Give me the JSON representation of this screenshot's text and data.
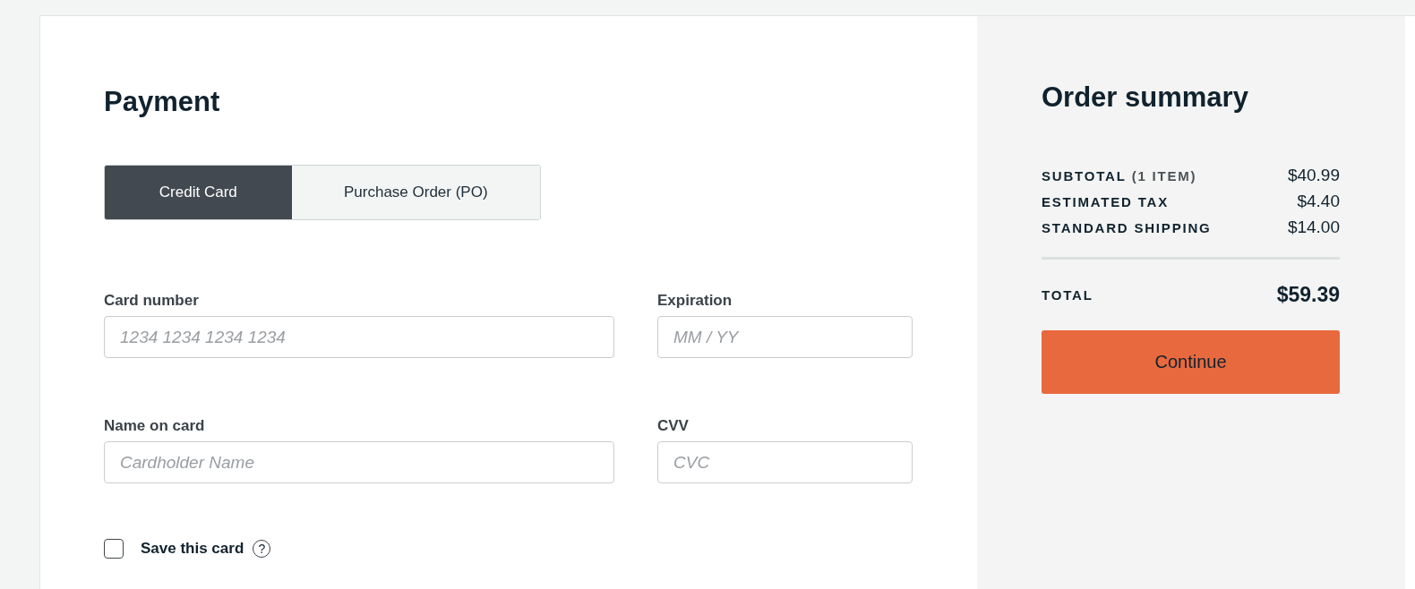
{
  "payment": {
    "title": "Payment",
    "tabs": [
      {
        "label": "Credit Card",
        "selected": true
      },
      {
        "label": "Purchase Order (PO)",
        "selected": false
      }
    ],
    "fields": [
      {
        "label": "Card number",
        "placeholder": "1234 1234 1234 1234"
      },
      {
        "label": "Expiration",
        "placeholder": "MM / YY"
      },
      {
        "label": "Name on card",
        "placeholder": "Cardholder Name"
      },
      {
        "label": "CVV",
        "placeholder": "CVC"
      }
    ],
    "save_card": {
      "label": "Save this card",
      "checked": false,
      "help_icon": "?"
    }
  },
  "order_summary": {
    "title": "Order summary",
    "lines": [
      {
        "label": "SUBTOTAL",
        "note": "(1 ITEM)",
        "amount": "$40.99"
      },
      {
        "label": "ESTIMATED TAX",
        "amount": "$4.40"
      },
      {
        "label": "STANDARD SHIPPING",
        "amount": "$14.00"
      }
    ],
    "total": {
      "label": "TOTAL",
      "amount": "$59.39"
    },
    "button": "Continue"
  }
}
